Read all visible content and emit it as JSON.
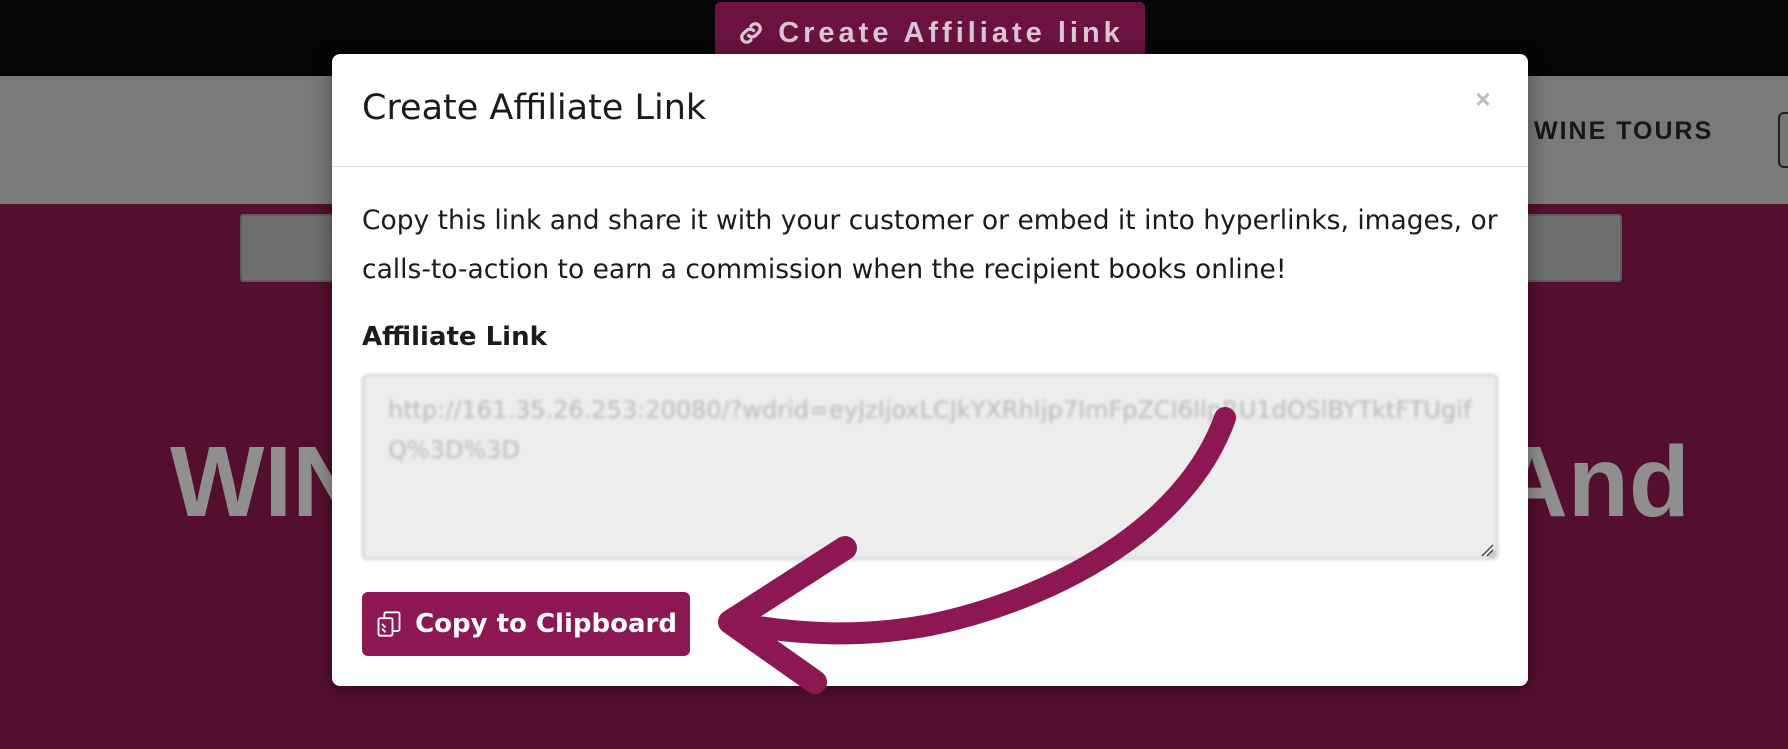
{
  "background_page": {
    "top_button_label": "Create Affiliate link",
    "nav_item_label": "WINE TOURS",
    "hero_title_left": "WIN",
    "hero_title_right": "And"
  },
  "modal": {
    "title": "Create Affiliate Link",
    "close_symbol": "×",
    "description": "Copy this link and share it with your customer or embed it into hyperlinks, images, or calls-to-action to earn a commission when the recipient books online!",
    "field_label": "Affiliate Link",
    "link_value": "http://161.35.26.253:20080/?wdrid=eyJzIjoxLCJkYXRhIjp7ImFpZCI6IlpRU1dOSlBYTktFTUgifQ%3D%3D",
    "copy_button_label": "Copy to Clipboard"
  },
  "icons": {
    "top_button_icon": "link-icon",
    "copy_button_icon": "clipboard-copy-icon",
    "close_icon": "close-icon"
  },
  "colors": {
    "brand": "#8c1753",
    "hero_background": "#540f2e",
    "arrow": "#8c1753"
  }
}
